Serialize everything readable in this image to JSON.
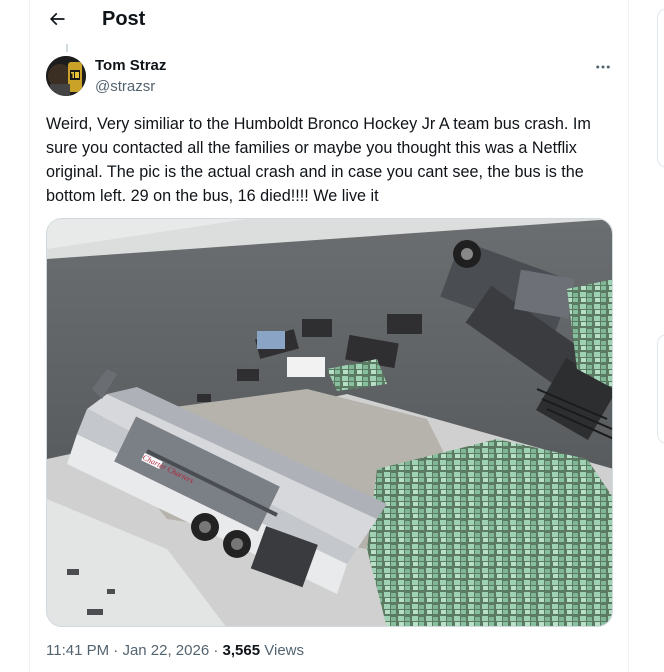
{
  "header": {
    "title": "Post",
    "back_icon": "arrow-left-icon"
  },
  "tweet": {
    "author_name": "Tom Straz",
    "author_handle": "@strazsr",
    "more_icon": "more-horizontal-icon",
    "text": "Weird, Very similiar to the Humboldt Bronco Hockey Jr A team bus crash. Im sure you contacted all the families or maybe you thought this was a Netflix original. The pic is the actual crash and in case you cant see, the bus is the bottom left. 29 on the bus, 16 died!!!! We live it",
    "image_bus_text": "Charter Charters",
    "time": "11:41 PM",
    "separator": "·",
    "date": "Jan 22, 2026",
    "views_count": "3,565",
    "views_label": "Views"
  },
  "colors": {
    "text_primary": "#0f1419",
    "text_secondary": "#536471",
    "border": "#eff3f4",
    "accent_cargo": "#6fa88a"
  }
}
